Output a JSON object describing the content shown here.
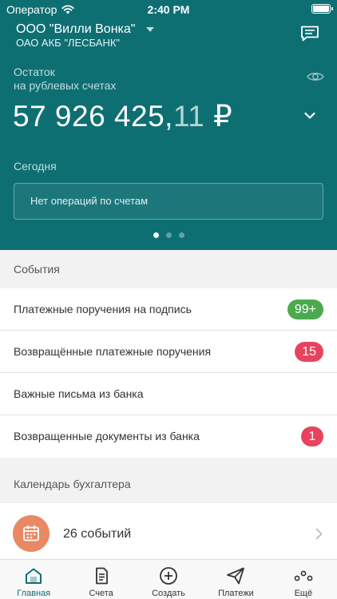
{
  "status_bar": {
    "carrier": "Оператор",
    "time": "2:40 PM"
  },
  "header": {
    "org_name": "ООО \"Вилли Вонка\"",
    "bank_name": "ОАО АКБ \"ЛЕСБАНК\""
  },
  "balance": {
    "label_line1": "Остаток",
    "label_line2": "на рублевых счетах",
    "amount_whole": "57 926 425,",
    "amount_fraction": "11",
    "currency": "₽"
  },
  "today": {
    "label": "Сегодня",
    "empty_message": "Нет операций по счетам"
  },
  "events": {
    "title": "События",
    "items": [
      {
        "label": "Платежные поручения на подпись",
        "badge": "99+"
      },
      {
        "label": "Возвращённые платежные поручения",
        "badge": "15"
      },
      {
        "label": "Важные письма из банка",
        "badge": ""
      },
      {
        "label": "Возвращенные документы из банка",
        "badge": "1"
      }
    ]
  },
  "calendar": {
    "title": "Календарь бухгалтера",
    "summary": "26 событий"
  },
  "tabs": [
    {
      "label": "Главная",
      "icon": "home-icon"
    },
    {
      "label": "Счета",
      "icon": "document-icon"
    },
    {
      "label": "Создать",
      "icon": "plus-circle-icon"
    },
    {
      "label": "Платежи",
      "icon": "send-icon"
    },
    {
      "label": "Ещё",
      "icon": "more-icon"
    }
  ],
  "colors": {
    "brand": "#0e6f73",
    "badge_green": "#4caa4e",
    "badge_red": "#e8435d",
    "calendar_accent": "#e98964"
  }
}
